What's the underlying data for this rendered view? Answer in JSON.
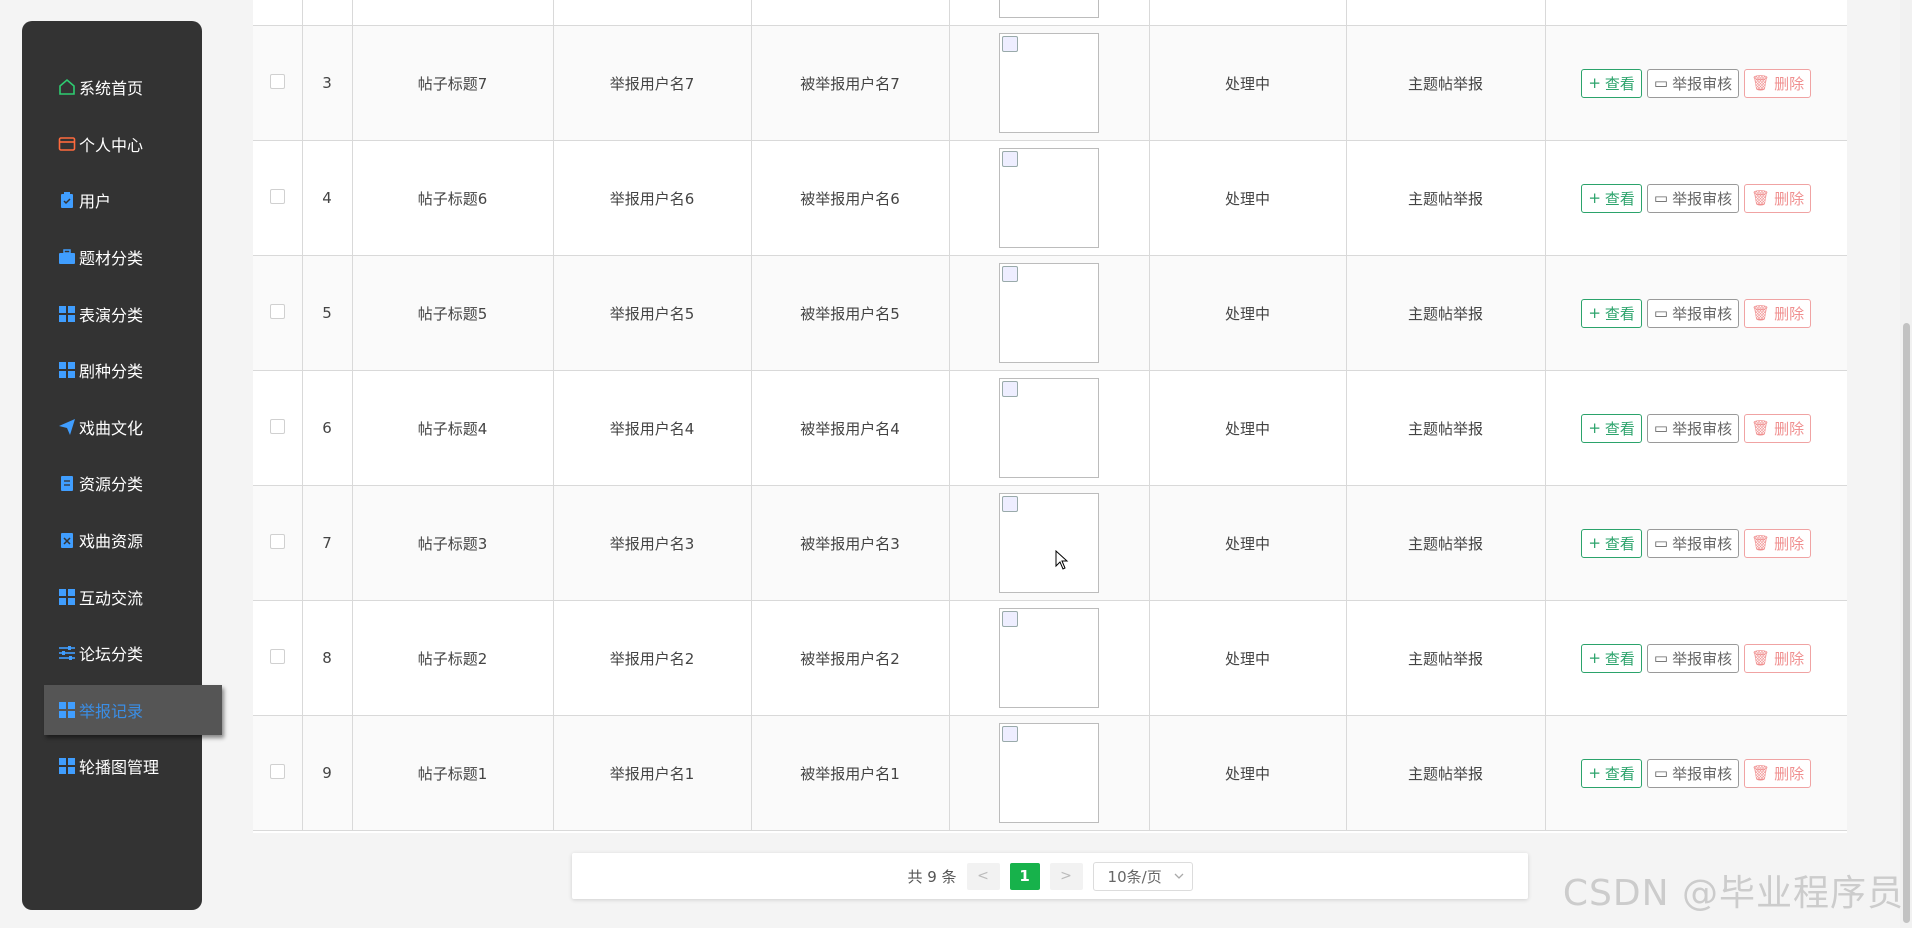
{
  "sidebar": {
    "items": [
      {
        "label": "系统首页",
        "icon": "home-icon",
        "color": "#2ecc71"
      },
      {
        "label": "个人中心",
        "icon": "card-icon",
        "color": "#ff6a3d"
      },
      {
        "label": "用户",
        "icon": "clipboard-icon",
        "color": "#409eff"
      },
      {
        "label": "题材分类",
        "icon": "briefcase-icon",
        "color": "#409eff"
      },
      {
        "label": "表演分类",
        "icon": "grid-icon",
        "color": "#409eff"
      },
      {
        "label": "剧种分类",
        "icon": "grid-icon",
        "color": "#409eff"
      },
      {
        "label": "戏曲文化",
        "icon": "send-icon",
        "color": "#409eff"
      },
      {
        "label": "资源分类",
        "icon": "document-icon",
        "color": "#409eff"
      },
      {
        "label": "戏曲资源",
        "icon": "close-doc-icon",
        "color": "#409eff"
      },
      {
        "label": "互动交流",
        "icon": "grid-icon",
        "color": "#409eff"
      },
      {
        "label": "论坛分类",
        "icon": "sliders-icon",
        "color": "#409eff"
      },
      {
        "label": "举报记录",
        "icon": "grid-icon",
        "color": "#409eff",
        "active": true
      },
      {
        "label": "轮播图管理",
        "icon": "grid-icon",
        "color": "#409eff"
      }
    ]
  },
  "table": {
    "rows": [
      {
        "index": "3",
        "title": "帖子标题7",
        "reporter": "举报用户名7",
        "reported": "被举报用户名7",
        "status": "处理中",
        "type": "主题帖举报"
      },
      {
        "index": "4",
        "title": "帖子标题6",
        "reporter": "举报用户名6",
        "reported": "被举报用户名6",
        "status": "处理中",
        "type": "主题帖举报"
      },
      {
        "index": "5",
        "title": "帖子标题5",
        "reporter": "举报用户名5",
        "reported": "被举报用户名5",
        "status": "处理中",
        "type": "主题帖举报"
      },
      {
        "index": "6",
        "title": "帖子标题4",
        "reporter": "举报用户名4",
        "reported": "被举报用户名4",
        "status": "处理中",
        "type": "主题帖举报"
      },
      {
        "index": "7",
        "title": "帖子标题3",
        "reporter": "举报用户名3",
        "reported": "被举报用户名3",
        "status": "处理中",
        "type": "主题帖举报"
      },
      {
        "index": "8",
        "title": "帖子标题2",
        "reporter": "举报用户名2",
        "reported": "被举报用户名2",
        "status": "处理中",
        "type": "主题帖举报"
      },
      {
        "index": "9",
        "title": "帖子标题1",
        "reporter": "举报用户名1",
        "reported": "被举报用户名1",
        "status": "处理中",
        "type": "主题帖举报"
      }
    ],
    "actions": {
      "view": "查看",
      "audit": "举报审核",
      "delete": "删除"
    }
  },
  "pagination": {
    "total": "共 9 条",
    "prev": "<",
    "current": "1",
    "next": ">",
    "page_size": "10条/页"
  },
  "watermark": "CSDN @毕业程序员"
}
